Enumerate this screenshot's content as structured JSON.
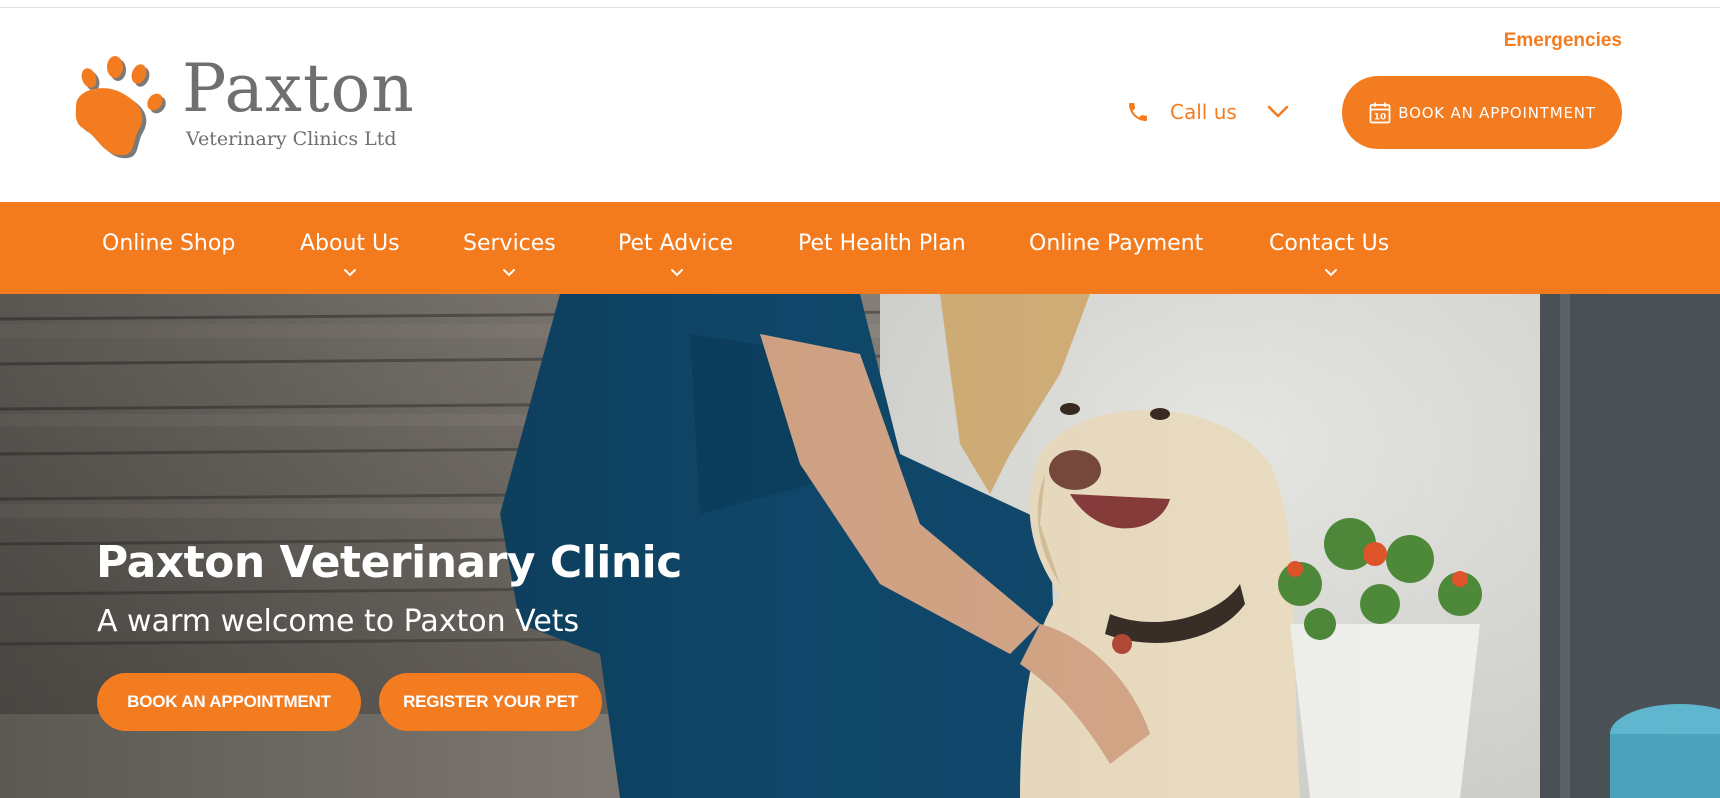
{
  "header": {
    "logo_name": "Paxton",
    "logo_sub": "Veterinary Clinics Ltd",
    "emergencies_label": "Emergencies",
    "call_label": "Call us",
    "book_label": "BOOK AN APPOINTMENT",
    "calendar_day": "10"
  },
  "nav": {
    "items": [
      {
        "label": "Online Shop",
        "has_dropdown": false
      },
      {
        "label": "About Us",
        "has_dropdown": true
      },
      {
        "label": "Services",
        "has_dropdown": true
      },
      {
        "label": "Pet Advice",
        "has_dropdown": true
      },
      {
        "label": "Pet Health Plan",
        "has_dropdown": false
      },
      {
        "label": "Online Payment",
        "has_dropdown": false
      },
      {
        "label": "Contact Us",
        "has_dropdown": true
      }
    ]
  },
  "hero": {
    "title": "Paxton Veterinary Clinic",
    "subtitle": "A warm welcome to Paxton Vets",
    "primary_button": "BOOK AN APPOINTMENT",
    "secondary_button": "REGISTER YOUR PET"
  },
  "colors": {
    "brand_orange": "#f47c20",
    "logo_gray": "#6f6f6f"
  },
  "icons": [
    "paw-logo-icon",
    "phone-icon",
    "chevron-down-icon",
    "calendar-icon"
  ]
}
